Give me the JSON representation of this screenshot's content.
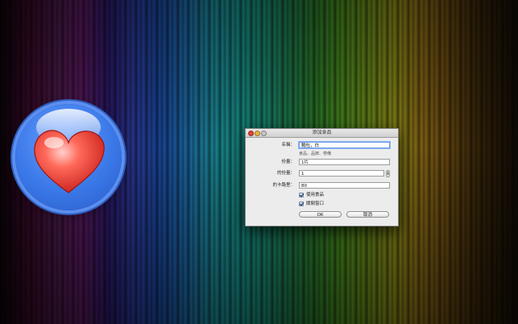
{
  "dialog": {
    "title": "添加食品",
    "fields": {
      "name": {
        "label": "名稱：",
        "value": "麵包，白",
        "hint": "食品、品牌、帶備"
      },
      "serving": {
        "label": "份量：",
        "value": "1片"
      },
      "servings": {
        "label": "的份量：",
        "value": "1"
      },
      "calories": {
        "label": "的卡路里：",
        "value": "80"
      }
    },
    "checkboxes": [
      {
        "label": "使用食品",
        "checked": true
      },
      {
        "label": "關閉窗口",
        "checked": true
      }
    ],
    "buttons": {
      "ok": "OK",
      "cancel": "取消"
    }
  },
  "icons": {
    "app_icon": "heart-app-icon",
    "close": "close-icon",
    "minimize": "minimize-icon",
    "zoom": "zoom-icon",
    "stepper": "stepper-icon",
    "checkmark": "checkmark-icon"
  },
  "colors": {
    "app_icon_blue": "#3a78e8",
    "heart_red": "#e0453a",
    "close_red": "#e0453a",
    "minimize_yellow": "#e8b53a",
    "focus_blue": "#6a9be8"
  }
}
